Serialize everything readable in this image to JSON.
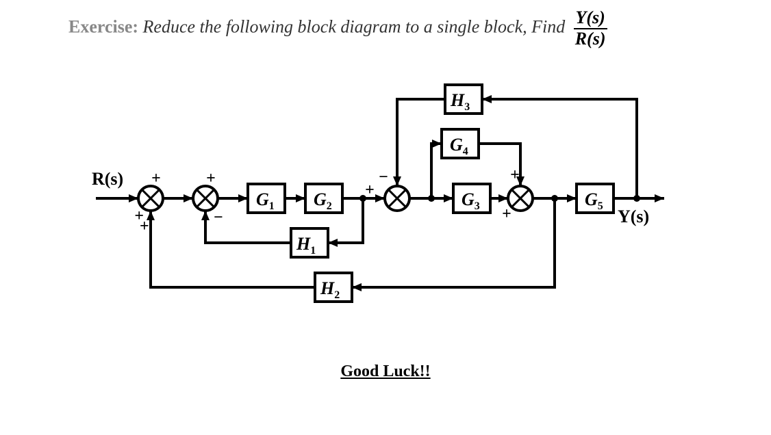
{
  "title": {
    "label": "Exercise:",
    "prompt": "Reduce the following block diagram to a single block, Find",
    "frac_num": "Y(s)",
    "frac_den": "R(s)"
  },
  "io": {
    "input": "R(s)",
    "output": "Y(s)"
  },
  "blocks": {
    "G1": "G",
    "G1_sub": "1",
    "G2": "G",
    "G2_sub": "2",
    "G3": "G",
    "G3_sub": "3",
    "G4": "G",
    "G4_sub": "4",
    "G5": "G",
    "G5_sub": "5",
    "H1": "H",
    "H1_sub": "1",
    "H2": "H",
    "H2_sub": "2",
    "H3": "H",
    "H3_sub": "3"
  },
  "signs": {
    "s1_top": "+",
    "s1_bottom": "+",
    "s2_top": "+",
    "s2_bottom": "−",
    "s3_top_left": "−",
    "s3_top_right": "+",
    "s4_top": "+",
    "s4_bottom": "+"
  },
  "footer": "Good Luck!!"
}
